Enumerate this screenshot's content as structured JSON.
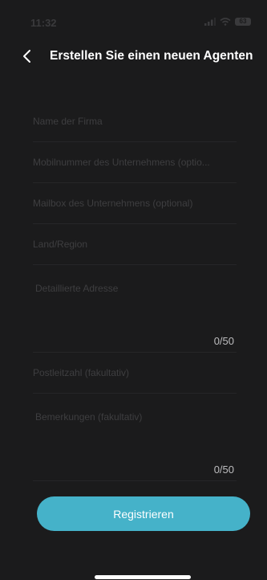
{
  "status_bar": {
    "time": "11:32",
    "battery": "63"
  },
  "header": {
    "title": "Erstellen Sie einen neuen Agenten"
  },
  "form": {
    "company_name": {
      "placeholder": "Name der Firma",
      "value": ""
    },
    "mobile_number": {
      "placeholder": "Mobilnummer des Unternehmens (optio...",
      "value": ""
    },
    "mailbox": {
      "placeholder": "Mailbox des Unternehmens (optional)",
      "value": ""
    },
    "country_region": {
      "placeholder": "Land/Region",
      "value": ""
    },
    "detailed_address": {
      "placeholder": "Detaillierte Adresse",
      "value": "",
      "counter": "0/50"
    },
    "postal_code": {
      "placeholder": "Postleitzahl (fakultativ)",
      "value": ""
    },
    "remarks": {
      "placeholder": "Bemerkungen (fakultativ)",
      "value": "",
      "counter": "0/50"
    }
  },
  "actions": {
    "register_label": "Registrieren"
  },
  "colors": {
    "background": "#1b1b1c",
    "accent": "#45b2c9",
    "placeholder": "#3e3e40"
  }
}
